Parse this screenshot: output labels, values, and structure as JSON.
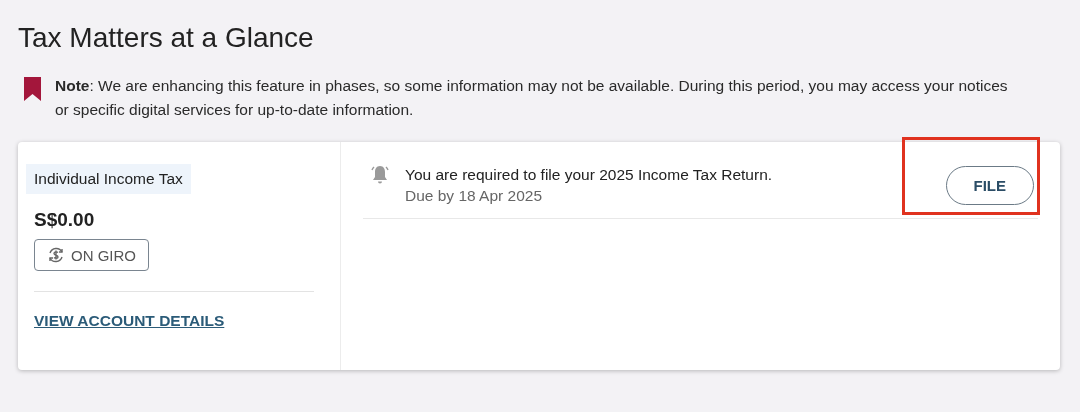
{
  "page": {
    "title": "Tax Matters at a Glance"
  },
  "note": {
    "text": "**Note**: We are enhancing this feature in phases, so some information may not be available. During this period, you may access your notices or specific digital services for up-to-date information."
  },
  "account": {
    "tax_type": "Individual Income Tax",
    "amount": "S$0.00",
    "giro_badge": "ON GIRO",
    "link": "VIEW ACCOUNT DETAILS"
  },
  "notifications": [
    {
      "message": "You are required to file your 2025 Income Tax Return.",
      "due": "Due by 18 Apr 2025",
      "action": "FILE",
      "highlighted": true
    }
  ]
}
